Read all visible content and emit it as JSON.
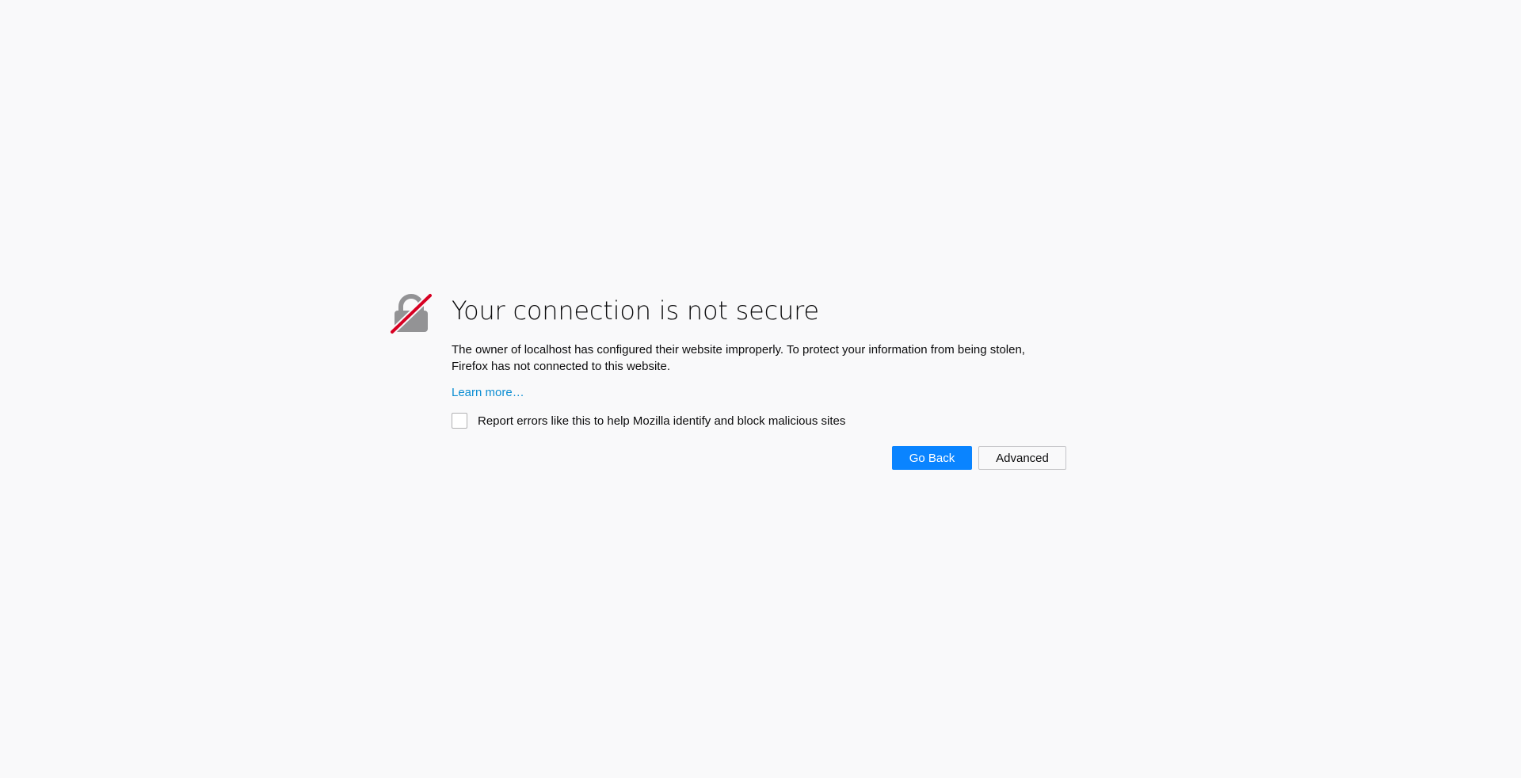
{
  "error": {
    "title": "Your connection is not secure",
    "description": "The owner of localhost has configured their website improperly. To protect your information from being stolen, Firefox has not connected to this website.",
    "learn_more": "Learn more…",
    "report_checkbox_label": "Report errors like this to help Mozilla identify and block malicious sites",
    "report_checkbox_checked": false,
    "icon": "broken-lock-icon"
  },
  "buttons": {
    "go_back": "Go Back",
    "advanced": "Advanced"
  },
  "colors": {
    "background": "#f9f9fa",
    "primary_button": "#0a84ff",
    "link": "#0a8dd2",
    "icon_gray": "#939395",
    "icon_slash": "#d70022"
  }
}
